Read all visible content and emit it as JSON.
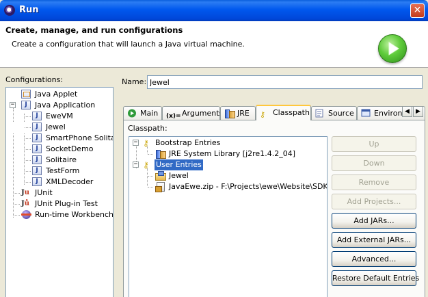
{
  "window": {
    "title": "Run",
    "close_label": "✕"
  },
  "header": {
    "title": "Create, manage, and run configurations",
    "subtitle": "Create a configuration that will launch a Java virtual machine."
  },
  "configurations": {
    "label": "Configurations:",
    "items": [
      {
        "label": "Java Applet",
        "icon": "java-applet-icon"
      },
      {
        "label": "Java Application",
        "icon": "java-application-icon",
        "expanded": true
      },
      {
        "label": "EweVM",
        "icon": "java-config-icon"
      },
      {
        "label": "Jewel",
        "icon": "java-config-icon",
        "selected": true
      },
      {
        "label": "SmartPhone Solitaire",
        "icon": "java-config-icon"
      },
      {
        "label": "SocketDemo",
        "icon": "java-config-icon"
      },
      {
        "label": "Solitaire",
        "icon": "java-config-icon"
      },
      {
        "label": "TestForm",
        "icon": "java-config-icon"
      },
      {
        "label": "XMLDecoder",
        "icon": "java-config-icon"
      },
      {
        "label": "JUnit",
        "icon": "junit-icon"
      },
      {
        "label": "JUnit Plug-in Test",
        "icon": "junit-plugin-icon"
      },
      {
        "label": "Run-time Workbench",
        "icon": "runtime-workbench-icon"
      }
    ]
  },
  "name_field": {
    "label": "Name:",
    "value": "Jewel"
  },
  "tabs": [
    {
      "label": "Main",
      "icon": "main-icon"
    },
    {
      "label": "Arguments",
      "icon": "arguments-icon"
    },
    {
      "label": "JRE",
      "icon": "jre-icon"
    },
    {
      "label": "Classpath",
      "icon": "classpath-icon",
      "active": true
    },
    {
      "label": "Source",
      "icon": "source-icon"
    },
    {
      "label": "Environ",
      "icon": "environment-icon"
    }
  ],
  "tab_scroll": {
    "left": "◀",
    "right": "▶"
  },
  "classpath": {
    "label": "Classpath:",
    "entries": [
      {
        "label": "Bootstrap Entries",
        "icon": "bootstrap-entries-icon",
        "expanded": true
      },
      {
        "label": "JRE System Library [j2re1.4.2_04]",
        "icon": "jre-library-icon"
      },
      {
        "label": "User Entries",
        "icon": "user-entries-icon",
        "expanded": true,
        "selected": true
      },
      {
        "label": "Jewel",
        "icon": "project-icon"
      },
      {
        "label": "JavaEwe.zip - F:\\Projects\\ewe\\Website\\SDK\\classes",
        "icon": "archive-icon"
      }
    ]
  },
  "buttons": [
    {
      "label": "Up",
      "enabled": false
    },
    {
      "label": "Down",
      "enabled": false
    },
    {
      "label": "Remove",
      "enabled": false
    },
    {
      "label": "Add Projects...",
      "enabled": false
    },
    {
      "label": "Add JARs...",
      "enabled": true
    },
    {
      "label": "Add External JARs...",
      "enabled": true
    },
    {
      "label": "Advanced...",
      "enabled": true
    },
    {
      "label": "Restore Default Entries",
      "enabled": true
    }
  ]
}
